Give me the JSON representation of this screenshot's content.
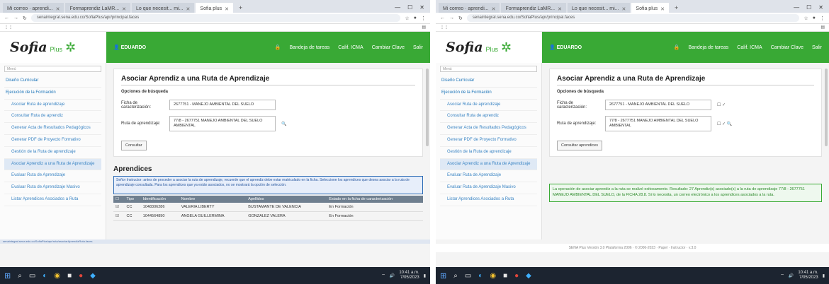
{
  "screens": [
    {
      "tabs": [
        "Mi correo · aprendi...",
        "Formaprendiz LaMR...",
        "Lo que necesit... mi...",
        "Sofia plus"
      ],
      "url": "senaintegral.sena.edu.co/SofiaPlus/apr/principal.faces",
      "user": "EDUARDO",
      "nav": [
        "Bandeja de tareas",
        "Calif. ICMA",
        "Cambiar Clave",
        "Salir"
      ],
      "sidebar_search": "Menú",
      "sidebar_items": [
        {
          "label": "Diseño Curricular",
          "sub": false,
          "on": false
        },
        {
          "label": "Ejecución de la Formación",
          "sub": false,
          "on": false
        },
        {
          "label": "Asociar Ruta de aprendizaje",
          "sub": true,
          "on": false
        },
        {
          "label": "Consultar Ruta de aprendiz",
          "sub": true,
          "on": false
        },
        {
          "label": "Generar Acta de Resultados Pedagógicos",
          "sub": true,
          "on": false
        },
        {
          "label": "Generar PDF de Proyecto Formativo",
          "sub": true,
          "on": false
        },
        {
          "label": "Gestión de la Ruta de aprendizaje",
          "sub": true,
          "on": false
        },
        {
          "label": "Asociar Aprendiz a una Ruta de Aprendizaje",
          "sub": true,
          "on": true
        },
        {
          "label": "Evaluar Ruta de Aprendizaje",
          "sub": true,
          "on": false
        },
        {
          "label": "Evaluar Ruta de Aprendizaje Masivo",
          "sub": true,
          "on": false
        },
        {
          "label": "Listar Aprendices Asociados a Ruta",
          "sub": true,
          "on": false
        }
      ],
      "title": "Asociar Aprendiz a una Ruta de Aprendizaje",
      "subheading": "Opciones de búsqueda",
      "field1_label": "Ficha de caracterización:",
      "field1_value": "2677751 - MANEJO AMBIENTAL DEL SUELO",
      "field2_label": "Ruta de aprendizaje:",
      "field2_value": "77/8 - 2677751 MANEJO AMBIENTAL DEL SUELO AMBIENTAL",
      "button": "Consultar",
      "apr_title": "Aprendices",
      "apr_notice": "Señor Instructor: antes de proceder a asociar la ruta de aprendizaje, recuerde que el aprendiz debe estar matriculado en la ficha. Seleccione los aprendices que desea asociar a la ruta de aprendizaje consultada. Para los aprendices que ya están asociados, no se mostrará la opción de selección.",
      "table_headers": [
        "Tipo",
        "Identificación",
        "Nombre",
        "Apellidos",
        "Estado en la ficha de caracterización"
      ],
      "rows": [
        [
          "CC",
          "1048306286",
          "VALERIA LIBERTY",
          "BUSTAMANTE DE VALENCIA",
          "En Formación"
        ],
        [
          "CC",
          "1044564890",
          "ANGELA GUILLERMINA",
          "GONZALEZ VALERA",
          "En Formación"
        ]
      ],
      "status_url": "senaintegral.sena.edu.co/SofiaPlus/apr/ruta/asociarAprendizRuta.faces",
      "clock": [
        "10:41 a.m.",
        "7/05/2023"
      ]
    },
    {
      "tabs": [
        "Mi correo · aprendi...",
        "Formaprendiz LaMR...",
        "Lo que necesit... mi...",
        "Sofia plus"
      ],
      "url": "senaintegral.sena.edu.co/SofiaPlus/apr/principal.faces",
      "user": "EDUARDO",
      "nav": [
        "Bandeja de tareas",
        "Calif. ICMA",
        "Cambiar Clave",
        "Salir"
      ],
      "sidebar_search": "Menú",
      "sidebar_items": [
        {
          "label": "Diseño Curricular",
          "sub": false,
          "on": false
        },
        {
          "label": "Ejecución de la Formación",
          "sub": false,
          "on": false
        },
        {
          "label": "Asociar Ruta de aprendizaje",
          "sub": true,
          "on": false
        },
        {
          "label": "Consultar Ruta de aprendiz",
          "sub": true,
          "on": false
        },
        {
          "label": "Generar Acta de Resultados Pedagógicos",
          "sub": true,
          "on": false
        },
        {
          "label": "Generar PDF de Proyecto Formativo",
          "sub": true,
          "on": false
        },
        {
          "label": "Gestión de la Ruta de aprendizaje",
          "sub": true,
          "on": false
        },
        {
          "label": "Asociar Aprendiz a una Ruta de Aprendizaje",
          "sub": true,
          "on": true
        },
        {
          "label": "Evaluar Ruta de Aprendizaje",
          "sub": true,
          "on": false
        },
        {
          "label": "Evaluar Ruta de Aprendizaje Masivo",
          "sub": true,
          "on": false
        },
        {
          "label": "Listar Aprendices Asociados a Ruta",
          "sub": true,
          "on": false
        }
      ],
      "title": "Asociar Aprendiz a una Ruta de Aprendizaje",
      "subheading": "Opciones de búsqueda",
      "field1_label": "Ficha de caracterización:",
      "field1_value": "2677751 - MANEJO AMBIENTAL DEL SUELO",
      "field1_extra": "☐ ✓",
      "field2_label": "Ruta de aprendizaje:",
      "field2_value": "77/8 - 2677751 MANEJO AMBIENTAL DEL SUELO AMBIENTAL",
      "field2_extra": "☐ ✓ 🔍",
      "button": "Consultar aprendices",
      "success": "La operación de asociar aprendiz a la ruta se realizó exitosamente. Resultado: 27 Aprendiz(s) asociado(s) a la ruta de aprendizaje 77/8 - 2677751 MANEJO AMBIENTAL DEL SUELO, de la FICHA 28.8. Si lo necesita, un correo electrónico a los aprendices asociados a la ruta.",
      "footer": "SENA Plus Versión 3.0 Plataforma 2006 · © 2006-2023 · Papel · Instructor · v.3.0",
      "clock": [
        "10:41 a.m.",
        "7/05/2023"
      ]
    }
  ]
}
